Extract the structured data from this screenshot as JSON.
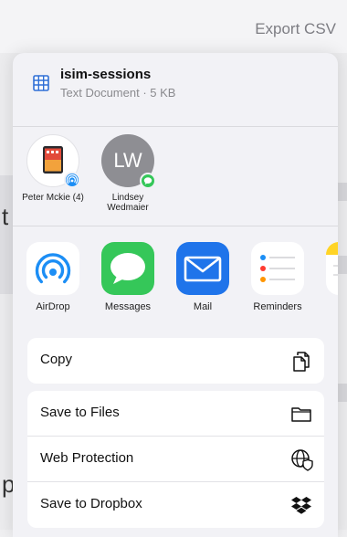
{
  "background": {
    "export_label": "Export CSV",
    "left_fragment_1": "t",
    "left_fragment_2": "p"
  },
  "document": {
    "title": "isim-sessions",
    "subtitle": "Text Document · 5 KB"
  },
  "people": [
    {
      "name": "Peter Mckie (4)",
      "avatar": "device",
      "badge": "airdrop-badge"
    },
    {
      "name": "Lindsey Wedmaier",
      "initials": "LW",
      "avatar": "initials",
      "badge": "messages-badge"
    }
  ],
  "apps": [
    {
      "label": "AirDrop",
      "icon": "airdrop-icon"
    },
    {
      "label": "Messages",
      "icon": "messages-icon"
    },
    {
      "label": "Mail",
      "icon": "mail-icon"
    },
    {
      "label": "Reminders",
      "icon": "reminders-icon"
    }
  ],
  "actions": {
    "copy": {
      "label": "Copy",
      "icon": "copy-icon"
    },
    "save_files": {
      "label": "Save to Files",
      "icon": "folder-icon"
    },
    "web_protection": {
      "label": "Web Protection",
      "icon": "globe-shield-icon"
    },
    "dropbox": {
      "label": "Save to Dropbox",
      "icon": "dropbox-icon"
    }
  },
  "colors": {
    "airdrop_blue": "#1c8ef5",
    "messages_green": "#35c759",
    "mail_blue": "#1f74ea",
    "reminders_white": "#ffffff"
  }
}
